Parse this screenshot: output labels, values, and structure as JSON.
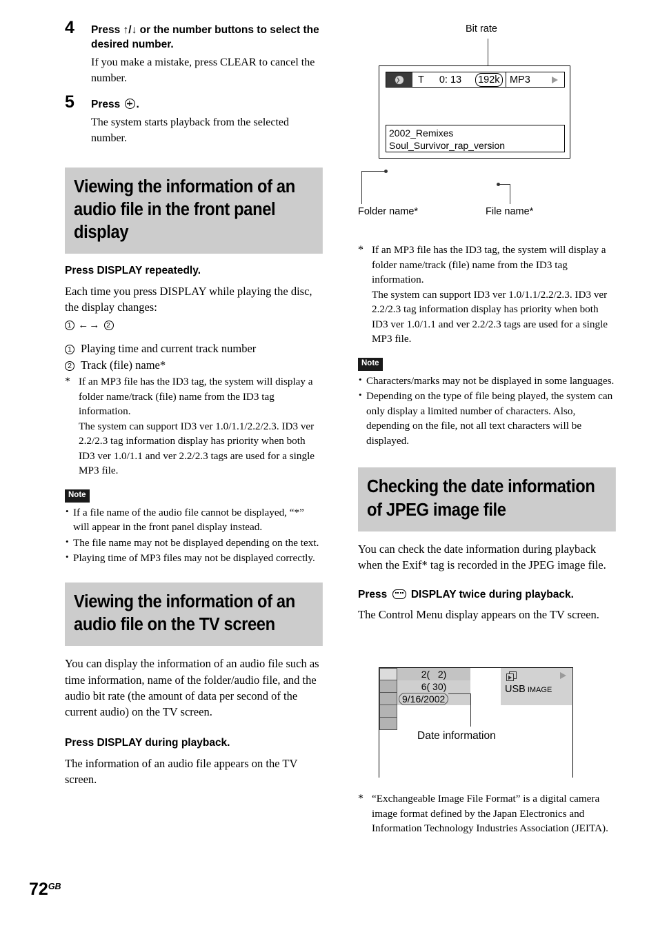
{
  "page": {
    "number": "72",
    "region": "GB"
  },
  "steps": [
    {
      "num": "4",
      "title_before": "Press ",
      "title_arrows": "↑/↓",
      "title_after": " or the number buttons to select the desired number.",
      "text": "If you make a mistake, press CLEAR to cancel the number."
    },
    {
      "num": "5",
      "title_before": "Press ",
      "title_after": ".",
      "text": "The system starts playback from the selected number."
    }
  ],
  "left_column": {
    "section1": {
      "heading": "Viewing the information of an audio file in the front panel display",
      "instruction": "Press DISPLAY repeatedly.",
      "intro": "Each time you press DISPLAY while playing the disc, the display changes:",
      "cycle": {
        "first": "1",
        "arrow": "←→",
        "second": "2"
      },
      "items": [
        {
          "marker": "1",
          "label": "Playing time and current track number"
        },
        {
          "marker": "2",
          "label": "Track (file) name*"
        }
      ],
      "footnote_star": "*",
      "footnote": "If an MP3 file has the ID3 tag, the system will display a folder name/track (file) name from the ID3 tag information.\nThe system can support ID3 ver 1.0/1.1/2.2/2.3. ID3 ver 2.2/2.3 tag information display has priority when both ID3 ver 1.0/1.1 and ver 2.2/2.3 tags are used for a single MP3 file.",
      "note_badge": "Note",
      "notes": [
        "If a file name of the audio file cannot be displayed, “*” will appear in the front panel display instead.",
        "The file name may not be displayed depending on the text.",
        "Playing time of MP3 files may not be displayed correctly."
      ]
    },
    "section2": {
      "heading": "Viewing the information of an audio file on the TV screen",
      "intro": "You can display the information of an audio file such as time information, name of the folder/audio file, and the audio bit rate (the amount of data per second of the current audio) on the TV screen.",
      "instruction": "Press DISPLAY during playback.",
      "result": "The information of an audio file appears on the TV screen."
    }
  },
  "right_column": {
    "diagram_audio": {
      "label_bitrate": "Bit rate",
      "label_folder": "Folder name*",
      "label_file": "File name*",
      "osd": {
        "clock_icon": "clock-icon",
        "track_marker": "T",
        "time": "0: 13",
        "bitrate": "192k",
        "format": "MP3",
        "play_icon": "play-icon"
      },
      "folder_name": "2002_Remixes",
      "file_name": "Soul_Survivor_rap_version"
    },
    "footnote_star": "*",
    "footnote": "If an MP3 file has the ID3 tag, the system will display a folder name/track (file) name from the ID3 tag information.\nThe system can support ID3 ver 1.0/1.1/2.2/2.3. ID3 ver 2.2/2.3 tag information display has priority when both ID3 ver 1.0/1.1 and ver 2.2/2.3 tags are used for a single MP3 file.",
    "note_badge": "Note",
    "notes": [
      "Characters/marks may not be displayed in some languages.",
      "Depending on the type of file being played, the system can only display a limited number of characters. Also, depending on the file, not all text characters will be displayed."
    ],
    "section3": {
      "heading": "Checking the date information of JPEG image file",
      "intro": "You can check the date information during playback when the Exif* tag is recorded in the JPEG image file.",
      "instruction_before": "Press ",
      "instruction_after": " DISPLAY twice during playback.",
      "result": "The Control Menu display appears on the TV screen."
    },
    "diagram_jpeg": {
      "rows": [
        "2(   2)",
        "6( 30)"
      ],
      "date": "9/16/2002",
      "label_date": "Date information",
      "badge_usb": "USB",
      "badge_image": "IMAGE",
      "stack_icon": "multi-image-icon",
      "play_icon": "play-icon"
    },
    "footnote2_star": "*",
    "footnote2": "“Exchangeable Image File Format” is a digital camera image format defined by the Japan Electronics and Information Technology Industries Association (JEITA)."
  },
  "colors": {
    "heading_bg": "#cccccc",
    "note_badge_bg": "#1a1a1a"
  }
}
